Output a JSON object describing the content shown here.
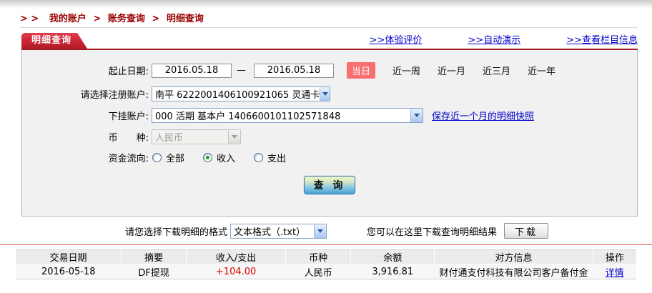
{
  "breadcrumb": {
    "prefix": "> >",
    "separator": ">",
    "items": [
      "我的账户",
      "账务查询",
      "明细查询"
    ]
  },
  "header": {
    "tab": "明细查询",
    "links": [
      ">>体验评价",
      ">>自动演示",
      ">>查看栏目信息"
    ]
  },
  "form": {
    "date_label": "起止日期:",
    "date_from": "2016.05.18",
    "date_to": "2016.05.18",
    "dash": "—",
    "today_button": "当日",
    "range_links": [
      "近一周",
      "近一月",
      "近三月",
      "近一年"
    ],
    "reg_account_label": "请选择注册账户:",
    "reg_account_value": "南平  6222001406100921065  灵通卡",
    "sub_account_label": "下挂账户:",
    "sub_account_value": "000  活期  基本户  1406600101102571848",
    "snapshot_link": "保存近一个月的明细快照",
    "currency_label": "币　　种:",
    "currency_value": "人民币",
    "flow_label": "资金流向:",
    "flow_options": [
      {
        "label": "全部",
        "checked": false
      },
      {
        "label": "收入",
        "checked": true
      },
      {
        "label": "支出",
        "checked": false
      }
    ],
    "query_button": "查 询"
  },
  "download": {
    "format_label": "请您选择下载明细的格式",
    "format_value": "文本格式（.txt）",
    "hint": "您可以在这里下载查询明细结果",
    "button": "下载"
  },
  "table": {
    "headers": [
      "交易日期",
      "摘要",
      "收入/支出",
      "币种",
      "余额",
      "对方信息",
      "操作"
    ],
    "rows": [
      {
        "date": "2016-05-18",
        "summary": "DF提现",
        "amount": "+104.00",
        "currency": "人民币",
        "balance": "3,916.81",
        "counterparty": "财付通支付科技有限公司客户备付金",
        "action": "详情"
      }
    ]
  },
  "colors": {
    "brand_red": "#b01d27",
    "breadcrumb_red": "#9a0000",
    "link_blue": "#0000cc",
    "amount_red": "#d40000",
    "today_button_bg": "#f96e6e",
    "panel_bg": "#f1f1f1"
  }
}
